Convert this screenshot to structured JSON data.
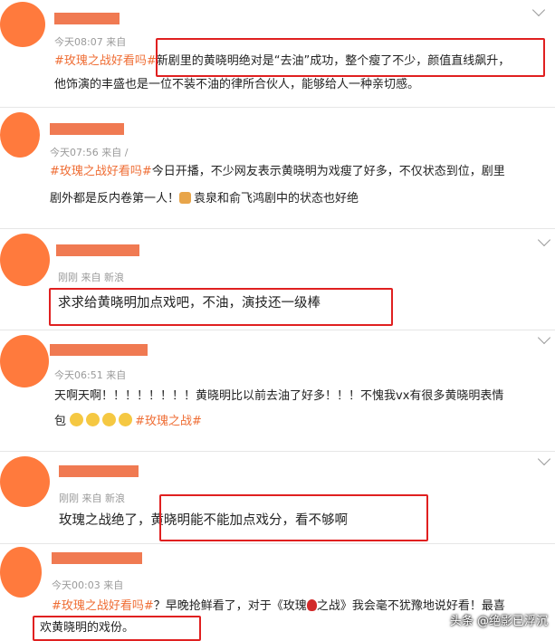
{
  "posts": [
    {
      "time": "今天08:07",
      "source": "来自",
      "segments": [
        {
          "text": "#玫瑰之战好看吗#",
          "tag": true
        },
        {
          "text": "新剧里的黄晓明绝对是“去油”成功，整个瘦了不少，颜值直线飙升，",
          "tag": false
        }
      ],
      "line2": "他饰演的丰盛也是一位不装不油的律所合伙人，能够给人一种亲切感。"
    },
    {
      "time": "今天07:56",
      "source": "来自 /",
      "segments": [
        {
          "text": "#玫瑰之战好看吗#",
          "tag": true
        },
        {
          "text": "今日开播，不少网友表示黄晓明为戏瘦了好多，不仅状态到位，剧里",
          "tag": false
        }
      ],
      "line2a": "剧外都是反内卷第一人！",
      "line2b": "袁泉和俞飞鸿剧中的状态也好绝"
    },
    {
      "time": "刚刚",
      "source": "来自 新浪",
      "line1": "求求给黄晓明加点戏吧，不油，演技还一级棒"
    },
    {
      "time": "今天06:51",
      "source": "来自",
      "line1": "天啊天啊！！！！！！！！黄晓明比以前去油了好多！！！不愧我vx有很多黄晓明表情",
      "line2a": "包",
      "line2tag": "#玫瑰之战#"
    },
    {
      "time": "刚刚",
      "source": "来自 新浪",
      "line1a": "玫瑰之战绝了，",
      "line1b": "黄晓明能不能加点戏分，看不够啊"
    },
    {
      "time": "今天00:03",
      "source": "来自",
      "segments": [
        {
          "text": "#玫瑰之战好看吗#",
          "tag": true
        },
        {
          "text": "？早晚抢鲜看了，对于《玫瑰",
          "tag": false
        }
      ],
      "line1c": "之战》我会毫不犹豫地说好看！最喜",
      "line2": "欢黄晓明的戏份。"
    }
  ],
  "watermark": "头条 @绝影已浮沉",
  "colors": {
    "tag": "#ef6d34",
    "highlight_box": "#e02020",
    "avatar": "#ff7a3d"
  },
  "icons": [
    "chevron-down-icon",
    "emoji-icon",
    "rose-icon"
  ]
}
